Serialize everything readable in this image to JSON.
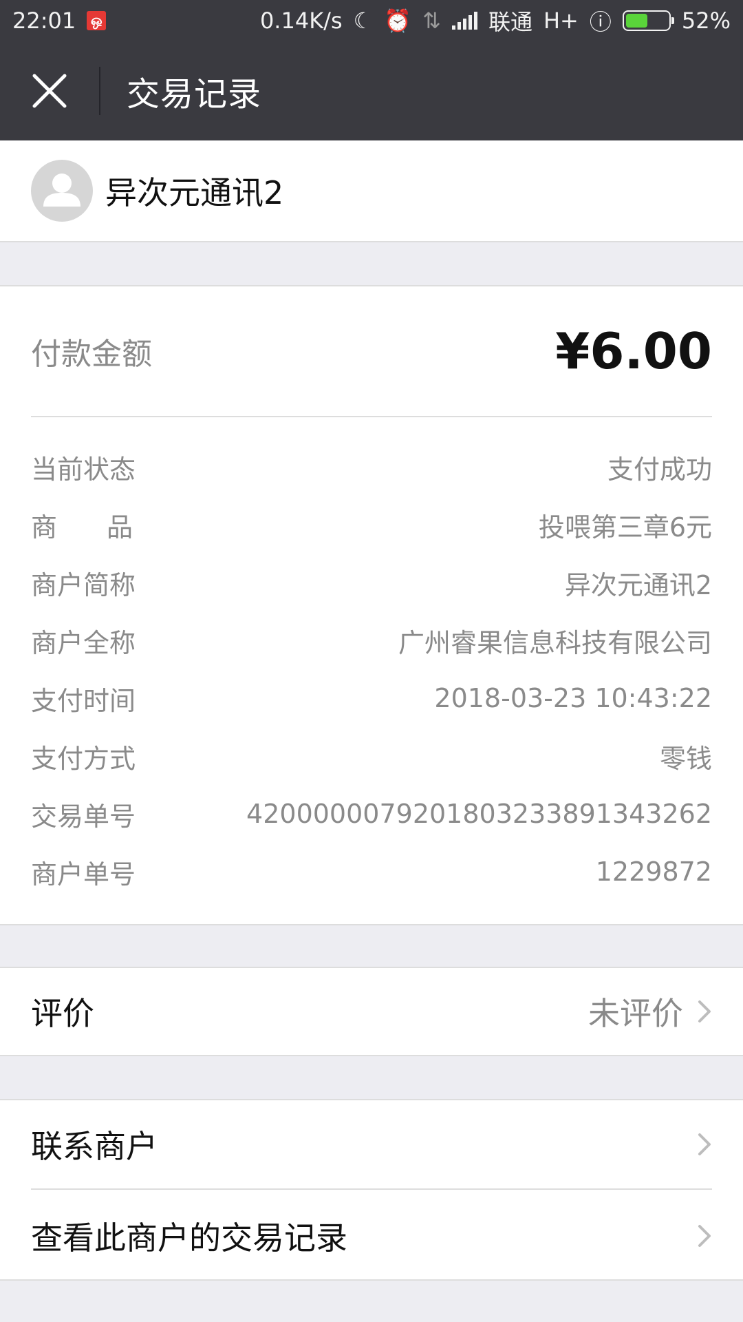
{
  "status_bar": {
    "time": "22:01",
    "network_speed": "0.14K/s",
    "carrier": "联通",
    "network_type": "H+",
    "battery": "52%",
    "battery_level": 0.52
  },
  "header": {
    "title": "交易记录"
  },
  "merchant": {
    "name": "异次元通讯2"
  },
  "payment": {
    "amount_label": "付款金额",
    "amount": "¥6.00",
    "rows": [
      {
        "label": "当前状态",
        "value": "支付成功"
      },
      {
        "label": "商品",
        "value": "投喂第三章6元"
      },
      {
        "label": "商户简称",
        "value": "异次元通讯2"
      },
      {
        "label": "商户全称",
        "value": "广州睿果信息科技有限公司"
      },
      {
        "label": "支付时间",
        "value": "2018-03-23 10:43:22"
      },
      {
        "label": "支付方式",
        "value": "零钱"
      },
      {
        "label": "交易单号",
        "value": "4200000079201803233891343262"
      },
      {
        "label": "商户单号",
        "value": "1229872"
      }
    ]
  },
  "rating": {
    "label": "评价",
    "value": "未评价"
  },
  "links": {
    "contact": "联系商户",
    "history": "查看此商户的交易记录"
  }
}
